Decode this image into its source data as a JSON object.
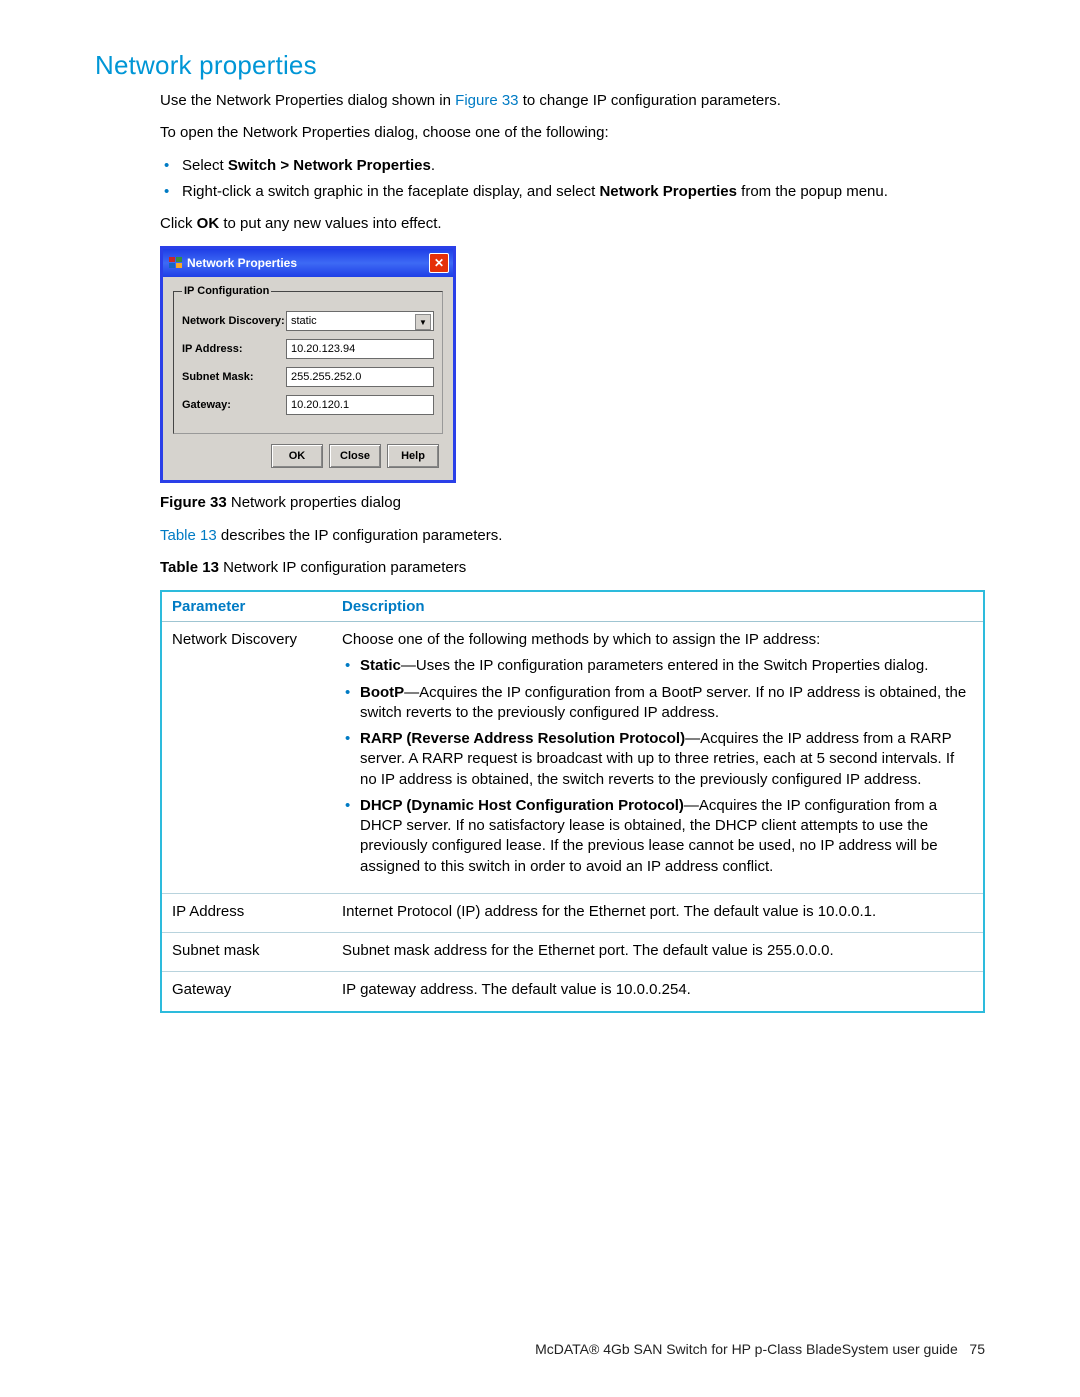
{
  "heading": "Network properties",
  "intro_p1_a": "Use the Network Properties dialog shown in ",
  "intro_p1_link": "Figure 33",
  "intro_p1_b": " to change IP configuration parameters.",
  "intro_p2": "To open the Network Properties dialog, choose one of the following:",
  "open_methods": {
    "m1_a": "Select ",
    "m1_b": "Switch > Network Properties",
    "m1_c": ".",
    "m2_a": "Right-click a switch graphic in the faceplate display, and select ",
    "m2_b": "Network Properties",
    "m2_c": " from the popup menu."
  },
  "intro_p3_a": "Click ",
  "intro_p3_b": "OK",
  "intro_p3_c": " to put any new values into effect.",
  "dialog": {
    "title": "Network Properties",
    "group_legend": "IP Configuration",
    "labels": {
      "discovery": "Network Discovery:",
      "ip": "IP Address:",
      "subnet": "Subnet Mask:",
      "gateway": "Gateway:"
    },
    "values": {
      "discovery": "static",
      "ip": "10.20.123.94",
      "subnet": "255.255.252.0",
      "gateway": "10.20.120.1"
    },
    "buttons": {
      "ok": "OK",
      "close": "Close",
      "help": "Help"
    }
  },
  "figure_caption": {
    "label": "Figure 33",
    "text": " Network properties dialog"
  },
  "table_ref_a": "Table 13",
  "table_ref_b": " describes the IP configuration parameters.",
  "table_caption": {
    "label": "Table 13",
    "text": "   Network IP configuration parameters"
  },
  "table": {
    "headers": {
      "col1": "Parameter",
      "col2": "Description"
    },
    "row1": {
      "param": "Network Discovery",
      "lead": "Choose one of the following methods by which to assign the IP address:",
      "items": {
        "static_b": "Static",
        "static_t": "—Uses the IP configuration parameters entered in the Switch Properties dialog.",
        "bootp_b": "BootP",
        "bootp_t": "—Acquires the IP configuration from a BootP server. If no IP address is obtained, the switch reverts to the previously configured IP address.",
        "rarp_b": "RARP (Reverse Address Resolution Protocol)",
        "rarp_t": "—Acquires the IP address from a RARP server. A RARP request is broadcast with up to three retries, each at 5 second intervals. If no IP address is obtained, the switch reverts to the previously configured IP address.",
        "dhcp_b": "DHCP (Dynamic Host Configuration Protocol)",
        "dhcp_t": "—Acquires the IP configuration from a DHCP server. If no satisfactory lease is obtained, the DHCP client attempts to use the previously configured lease. If the previous lease cannot be used, no IP address will be assigned to this switch in order to avoid an IP address conflict."
      }
    },
    "row2": {
      "param": "IP Address",
      "desc": "Internet Protocol (IP) address for the Ethernet port. The default value is 10.0.0.1."
    },
    "row3": {
      "param": "Subnet mask",
      "desc": "Subnet mask address for the Ethernet port. The default value is 255.0.0.0."
    },
    "row4": {
      "param": "Gateway",
      "desc": "IP gateway address. The default value is 10.0.0.254."
    }
  },
  "footer": {
    "text": "McDATA® 4Gb SAN Switch for HP p-Class BladeSystem user guide",
    "page": "75"
  }
}
